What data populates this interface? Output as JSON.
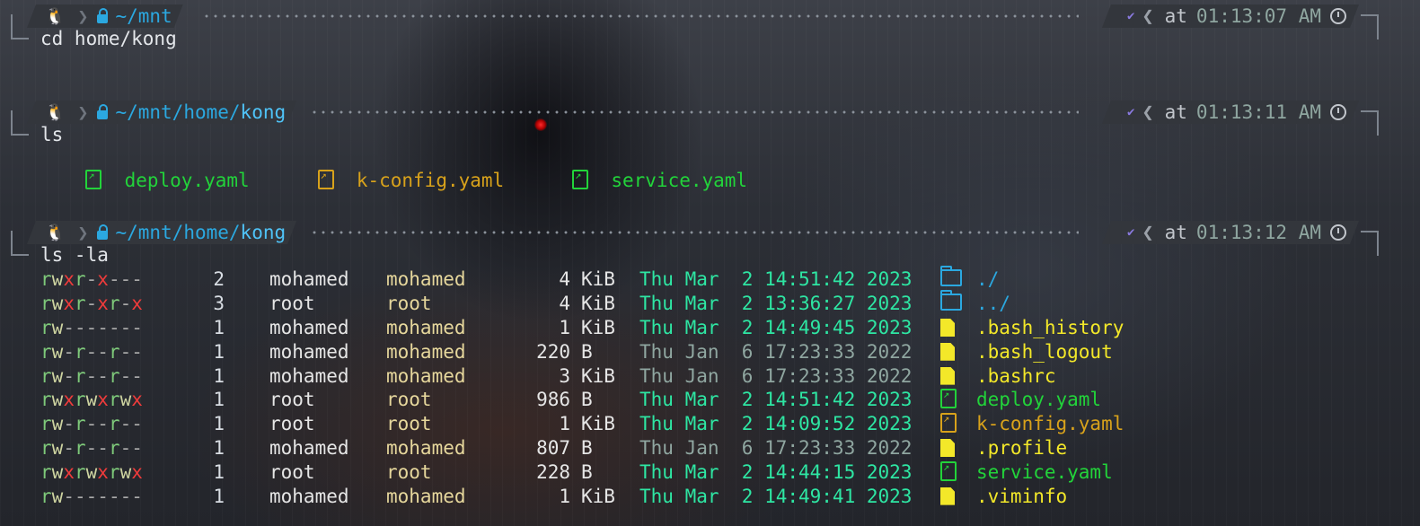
{
  "colors": {
    "accent_blue": "#2ba8e0",
    "green": "#22d33a",
    "orange": "#d8a21b",
    "yellow": "#f3e829",
    "teal": "#2ee6a3",
    "red": "#ef3b3b"
  },
  "prompts": [
    {
      "path_prefix": "~/mnt",
      "path_last": "",
      "at": "at",
      "time": "01:13:07 AM",
      "command": "cd home/kong"
    },
    {
      "path_prefix": "~/mnt/home/",
      "path_last": "kong",
      "at": "at",
      "time": "01:13:11 AM",
      "command": "ls"
    },
    {
      "path_prefix": "~/mnt/home/",
      "path_last": "kong",
      "at": "at",
      "time": "01:13:12 AM",
      "command": "ls -la"
    }
  ],
  "ls_output": [
    {
      "name": "deploy.yaml",
      "color": "green",
      "icon": "file-link-icon"
    },
    {
      "name": "k-config.yaml",
      "color": "orange",
      "icon": "file-link-icon"
    },
    {
      "name": "service.yaml",
      "color": "green",
      "icon": "file-link-icon"
    }
  ],
  "ls_la": [
    {
      "perm": "rwxr-x---",
      "links": "2",
      "user": "mohamed",
      "group": "mohamed",
      "size": "4",
      "unit": "KiB",
      "date": "Thu Mar  2 14:51:42 2023",
      "recent": true,
      "icon": "folder-icon",
      "name": "./",
      "color": "blue"
    },
    {
      "perm": "rwxr-xr-x",
      "links": "3",
      "user": "root",
      "group": "root",
      "size": "4",
      "unit": "KiB",
      "date": "Thu Mar  2 13:36:27 2023",
      "recent": true,
      "icon": "folder-icon",
      "name": "../",
      "color": "blue"
    },
    {
      "perm": "rw-------",
      "links": "1",
      "user": "mohamed",
      "group": "mohamed",
      "size": "1",
      "unit": "KiB",
      "date": "Thu Mar  2 14:49:45 2023",
      "recent": true,
      "icon": "document-icon",
      "name": ".bash_history",
      "color": "yellow"
    },
    {
      "perm": "rw-r--r--",
      "links": "1",
      "user": "mohamed",
      "group": "mohamed",
      "size": "220",
      "unit": "B",
      "date": "Thu Jan  6 17:23:33 2022",
      "recent": false,
      "icon": "document-icon",
      "name": ".bash_logout",
      "color": "yellow"
    },
    {
      "perm": "rw-r--r--",
      "links": "1",
      "user": "mohamed",
      "group": "mohamed",
      "size": "3",
      "unit": "KiB",
      "date": "Thu Jan  6 17:23:33 2022",
      "recent": false,
      "icon": "document-icon",
      "name": ".bashrc",
      "color": "yellow"
    },
    {
      "perm": "rwxrwxrwx",
      "links": "1",
      "user": "root",
      "group": "root",
      "size": "986",
      "unit": "B",
      "date": "Thu Mar  2 14:51:42 2023",
      "recent": true,
      "icon": "file-link-icon",
      "name": "deploy.yaml",
      "color": "green"
    },
    {
      "perm": "rw-r--r--",
      "links": "1",
      "user": "root",
      "group": "root",
      "size": "1",
      "unit": "KiB",
      "date": "Thu Mar  2 14:09:52 2023",
      "recent": true,
      "icon": "file-link-icon",
      "name": "k-config.yaml",
      "color": "orange"
    },
    {
      "perm": "rw-r--r--",
      "links": "1",
      "user": "mohamed",
      "group": "mohamed",
      "size": "807",
      "unit": "B",
      "date": "Thu Jan  6 17:23:33 2022",
      "recent": false,
      "icon": "document-icon",
      "name": ".profile",
      "color": "yellow"
    },
    {
      "perm": "rwxrwxrwx",
      "links": "1",
      "user": "root",
      "group": "root",
      "size": "228",
      "unit": "B",
      "date": "Thu Mar  2 14:44:15 2023",
      "recent": true,
      "icon": "file-link-icon",
      "name": "service.yaml",
      "color": "green"
    },
    {
      "perm": "rw-------",
      "links": "1",
      "user": "mohamed",
      "group": "mohamed",
      "size": "1",
      "unit": "KiB",
      "date": "Thu Mar  2 14:49:41 2023",
      "recent": true,
      "icon": "document-icon",
      "name": ".viminfo",
      "color": "yellow"
    }
  ]
}
